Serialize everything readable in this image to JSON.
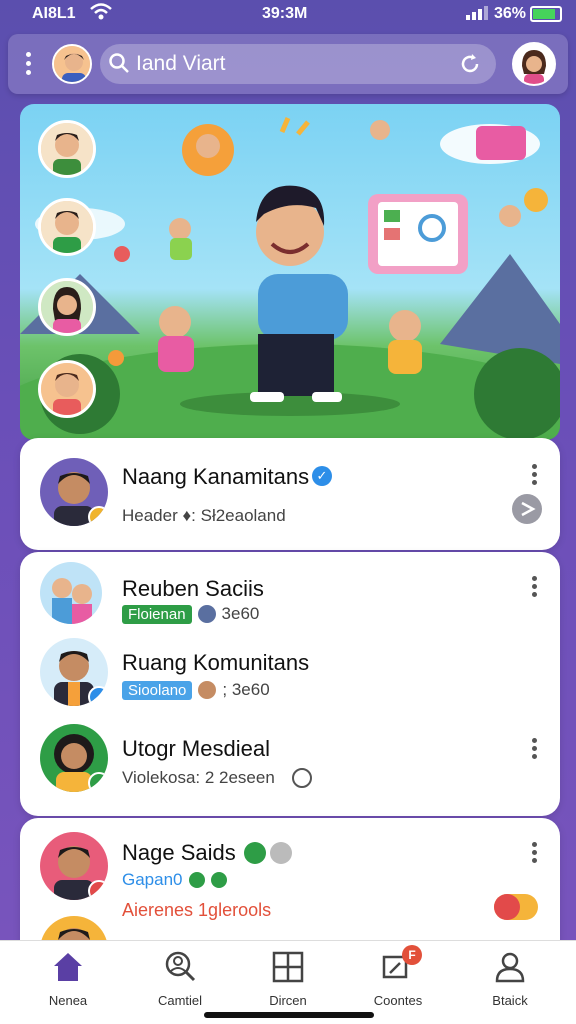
{
  "status_bar": {
    "carrier": "AI8L1",
    "time": "39:3M",
    "battery": "36%"
  },
  "app_bar": {
    "search_text": "Iand Viart"
  },
  "feed": [
    {
      "name": "Naang Kanamitans",
      "meta": "Header  ⁠♦:  Sł2eaoland",
      "verified": true,
      "badge_color": "#f0b42c"
    },
    {
      "name": "Reuben Saciis",
      "tag": "Floienan",
      "tag_color": "#2e9d46",
      "count": "3e60",
      "badge_color": "#2d8ee8"
    },
    {
      "name": "Ruang Komunitans",
      "tag": "Sioolano",
      "tag_color": "#4aa3e8",
      "count": "; 3e60",
      "badge_color": "#2d8ee8"
    },
    {
      "name": "Utogr Mesdieal",
      "meta": "Violekosa: 2 2eseen",
      "badge_color": "#2e9d46"
    },
    {
      "name": "Nage Saids",
      "tag": "Gapan0",
      "meta": "Aierenes 1glerools",
      "badge_color": "#e24a4a"
    }
  ],
  "bottom_nav": [
    {
      "label": "Nenea",
      "icon": "home-icon",
      "active": true
    },
    {
      "label": "Camtiel",
      "icon": "search-people-icon",
      "active": false
    },
    {
      "label": "Dircen",
      "icon": "grid-icon",
      "active": false
    },
    {
      "label": "Coontes",
      "icon": "chat-icon",
      "active": false,
      "badge": "F"
    },
    {
      "label": "Btaick",
      "icon": "profile-icon",
      "active": false
    }
  ],
  "colors": {
    "accent": "#5a3fa4",
    "background": "#6a4fb8"
  }
}
